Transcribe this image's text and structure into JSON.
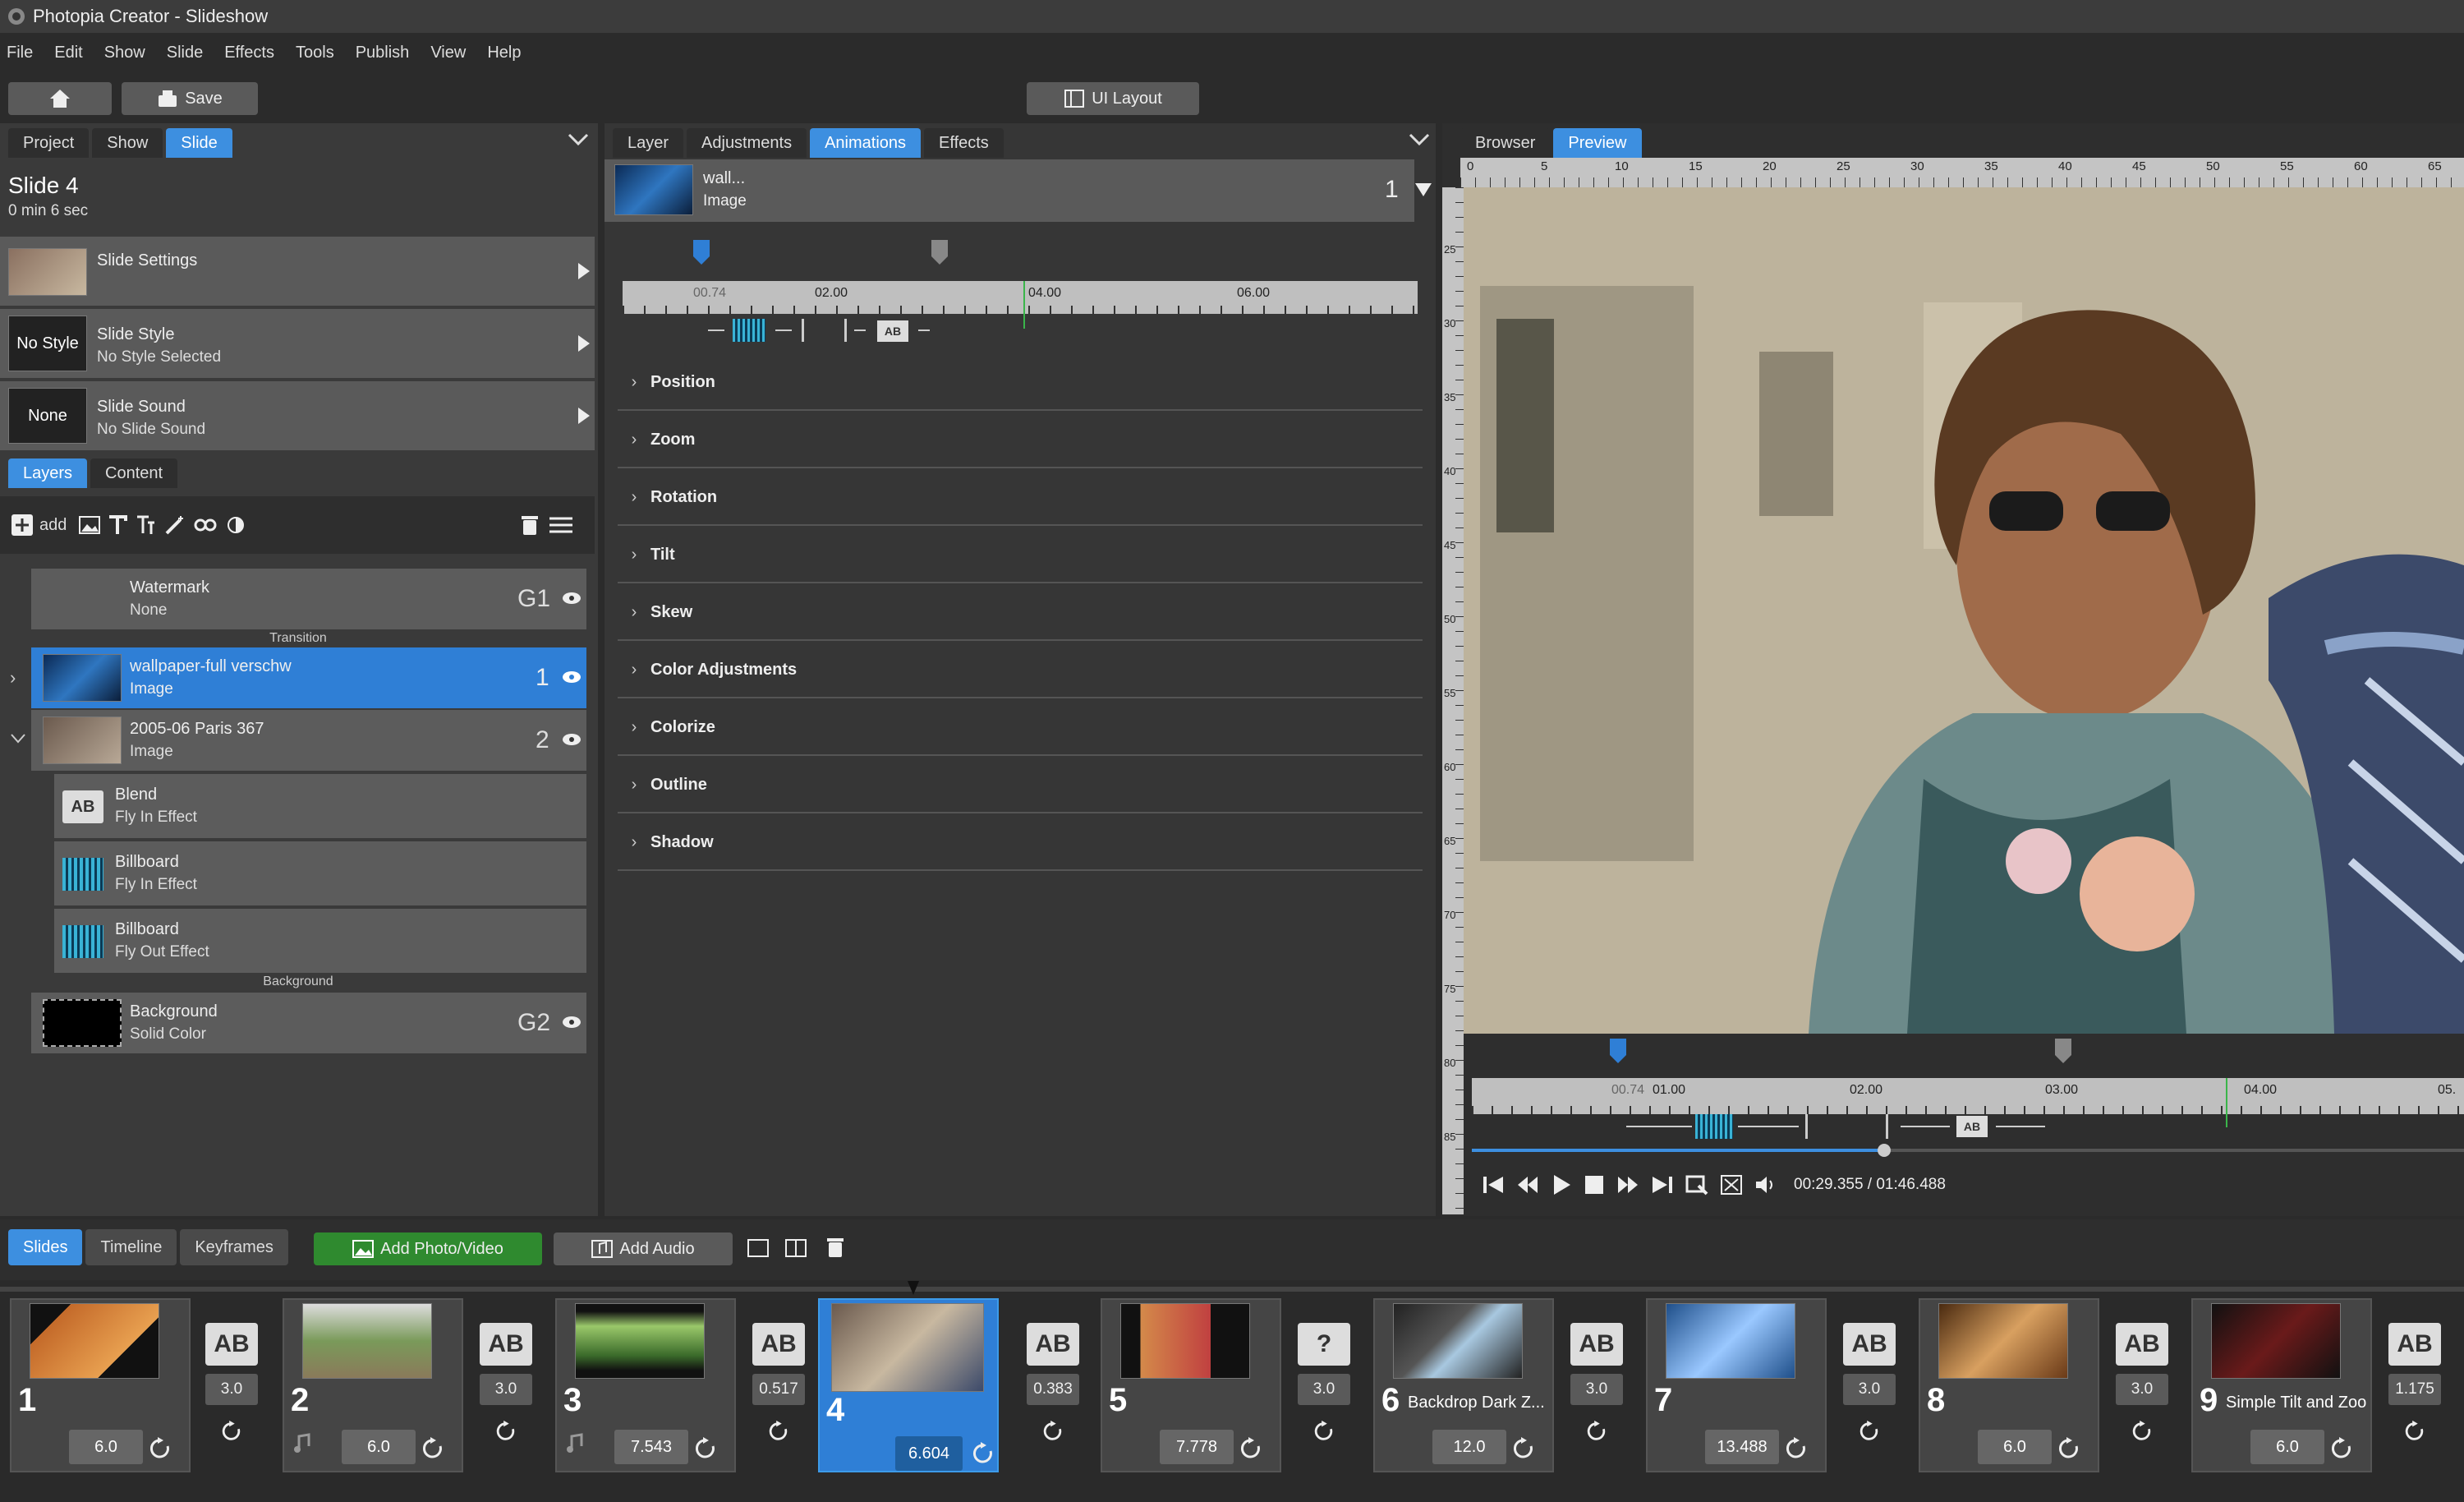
{
  "window": {
    "title": "Photopia Creator - Slideshow"
  },
  "menu": [
    "File",
    "Edit",
    "Show",
    "Slide",
    "Effects",
    "Tools",
    "Publish",
    "View",
    "Help"
  ],
  "toolbar": {
    "save": "Save",
    "ui_layout": "UI Layout"
  },
  "left": {
    "tabs": [
      "Project",
      "Show",
      "Slide"
    ],
    "active_tab": "Slide",
    "slide_title": "Slide 4",
    "slide_duration": "0 min 6 sec",
    "settings": [
      {
        "title": "Slide Settings",
        "subtitle": ""
      },
      {
        "badge": "No Style",
        "title": "Slide Style",
        "subtitle": "No Style Selected"
      },
      {
        "badge": "None",
        "title": "Slide Sound",
        "subtitle": "No Slide Sound"
      }
    ],
    "sub_tabs": [
      "Layers",
      "Content"
    ],
    "add_label": "add",
    "layers": [
      {
        "title": "Watermark",
        "subtitle": "None",
        "tag": "G1"
      },
      {
        "section": "Transition"
      },
      {
        "title": "wallpaper-full verschw",
        "subtitle": "Image",
        "tag": "1"
      },
      {
        "title": "2005-06 Paris 367",
        "subtitle": "Image",
        "tag": "2"
      },
      {
        "title": "Blend",
        "subtitle": "Fly In Effect"
      },
      {
        "title": "Billboard",
        "subtitle": "Fly In Effect"
      },
      {
        "title": "Billboard",
        "subtitle": "Fly Out Effect"
      },
      {
        "section": "Background"
      },
      {
        "title": "Background",
        "subtitle": "Solid Color",
        "tag": "G2"
      }
    ]
  },
  "middle": {
    "tabs": [
      "Layer",
      "Adjustments",
      "Animations",
      "Effects"
    ],
    "active_tab": "Animations",
    "layer_name": "wall...",
    "layer_type": "Image",
    "layer_num": "1",
    "ruler_labels": [
      "00.74",
      "02.00",
      "04.00",
      "06.00"
    ],
    "properties": [
      "Position",
      "Zoom",
      "Rotation",
      "Tilt",
      "Skew",
      "Color Adjustments",
      "Colorize",
      "Outline",
      "Shadow"
    ]
  },
  "right": {
    "tabs": [
      "Browser",
      "Preview"
    ],
    "active_tab": "Preview",
    "top_ruler": [
      "0",
      "5",
      "10",
      "15",
      "20",
      "25",
      "30",
      "35",
      "40",
      "45",
      "50",
      "55",
      "60",
      "65"
    ],
    "left_ruler": [
      "25",
      "30",
      "35",
      "40",
      "45",
      "50",
      "55",
      "60",
      "65",
      "70",
      "75",
      "80",
      "85"
    ],
    "timeline_labels": [
      "00.74",
      "01.00",
      "02.00",
      "03.00",
      "04.00",
      "05."
    ],
    "time": "00:29.355 / 01:46.488"
  },
  "bottom": {
    "tabs": [
      "Slides",
      "Timeline",
      "Keyframes"
    ],
    "active_tab": "Slides",
    "add_photo": "Add Photo/Video",
    "add_audio": "Add Audio",
    "slides": [
      {
        "num": "1",
        "dur": "6.0",
        "trans": "3.0",
        "name": ""
      },
      {
        "num": "2",
        "dur": "6.0",
        "trans": "3.0",
        "name": ""
      },
      {
        "num": "3",
        "dur": "7.543",
        "trans": "0.517",
        "name": ""
      },
      {
        "num": "4",
        "dur": "6.604",
        "trans": "0.383",
        "name": ""
      },
      {
        "num": "5",
        "dur": "7.778",
        "trans": "3.0",
        "name": ""
      },
      {
        "num": "6",
        "dur": "12.0",
        "trans": "3.0",
        "name": "Backdrop Dark Z..."
      },
      {
        "num": "7",
        "dur": "13.488",
        "trans": "3.0",
        "name": ""
      },
      {
        "num": "8",
        "dur": "6.0",
        "trans": "3.0",
        "name": ""
      },
      {
        "num": "9",
        "dur": "6.0",
        "trans": "1.175",
        "name": "Simple Tilt and Zoo"
      }
    ]
  },
  "colors": {
    "accent": "#3d8fe0",
    "panel": "#3a3a3a",
    "row": "#5a5a5a",
    "green": "#2f8a2f"
  }
}
